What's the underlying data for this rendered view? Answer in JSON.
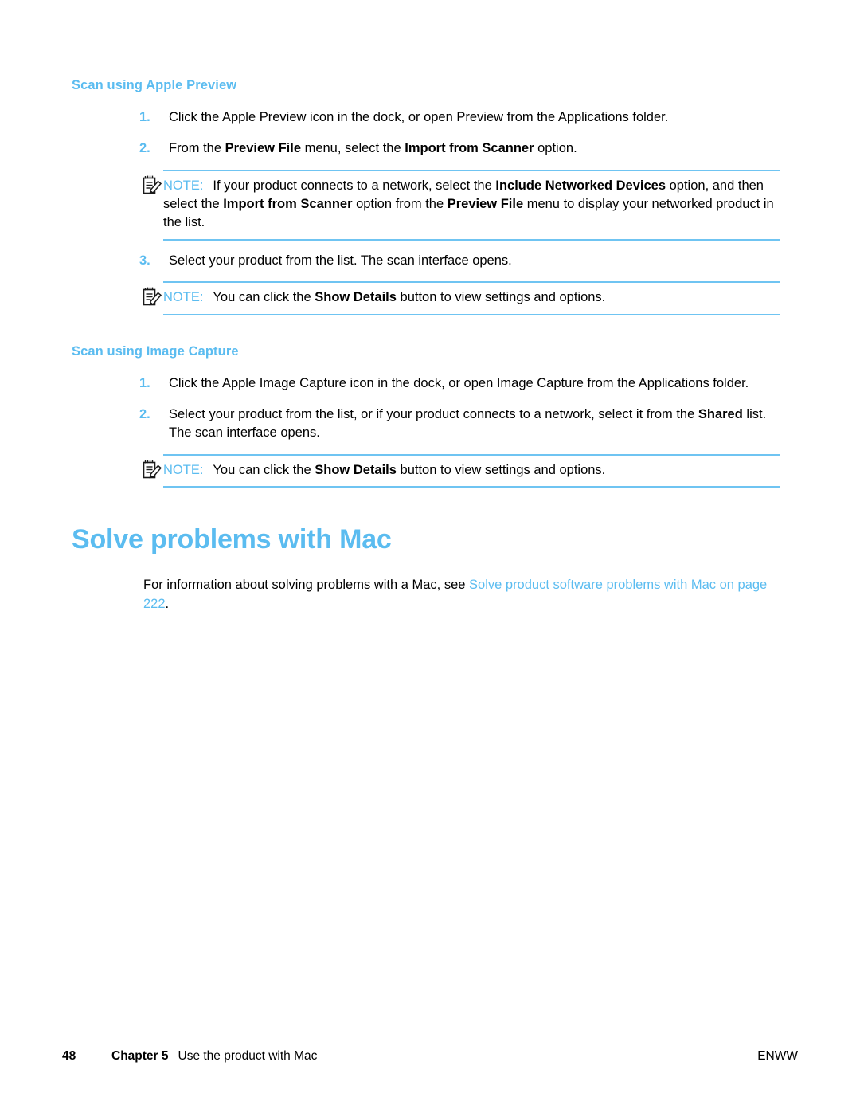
{
  "sections": [
    {
      "heading": "Scan using Apple Preview",
      "steps": [
        {
          "num": "1.",
          "runs": [
            {
              "t": "Click the Apple Preview icon in the dock, or open Preview from the Applications folder.",
              "b": false
            }
          ]
        },
        {
          "num": "2.",
          "runs": [
            {
              "t": "From the ",
              "b": false
            },
            {
              "t": "Preview File",
              "b": true
            },
            {
              "t": " menu, select the ",
              "b": false
            },
            {
              "t": "Import from Scanner",
              "b": true
            },
            {
              "t": " option.",
              "b": false
            }
          ]
        }
      ]
    }
  ],
  "note1": {
    "icon": "note-pad-pencil-icon",
    "label": "NOTE:",
    "runs": [
      {
        "t": "If your product connects to a network, select the ",
        "b": false
      },
      {
        "t": "Include Networked Devices",
        "b": true
      },
      {
        "t": " option, and then select the ",
        "b": false
      },
      {
        "t": "Import from Scanner",
        "b": true
      },
      {
        "t": " option from the ",
        "b": false
      },
      {
        "t": "Preview File",
        "b": true
      },
      {
        "t": " menu to display your networked product in the list.",
        "b": false
      }
    ]
  },
  "step3": {
    "num": "3.",
    "runs": [
      {
        "t": "Select your product from the list. The scan interface opens.",
        "b": false
      }
    ]
  },
  "note2": {
    "icon": "note-pad-pencil-icon",
    "label": "NOTE:",
    "runs": [
      {
        "t": "You can click the ",
        "b": false
      },
      {
        "t": "Show Details",
        "b": true
      },
      {
        "t": " button to view settings and options.",
        "b": false
      }
    ]
  },
  "section2": {
    "heading": "Scan using Image Capture",
    "steps": [
      {
        "num": "1.",
        "runs": [
          {
            "t": "Click the Apple Image Capture icon in the dock, or open Image Capture from the Applications folder.",
            "b": false
          }
        ]
      },
      {
        "num": "2.",
        "runs": [
          {
            "t": "Select your product from the list, or if your product connects to a network, select it from the ",
            "b": false
          },
          {
            "t": "Shared",
            "b": true
          },
          {
            "t": " list. The scan interface opens.",
            "b": false
          }
        ]
      }
    ]
  },
  "note3": {
    "icon": "note-pad-pencil-icon",
    "label": "NOTE:",
    "runs": [
      {
        "t": "You can click the ",
        "b": false
      },
      {
        "t": "Show Details",
        "b": true
      },
      {
        "t": " button to view settings and options.",
        "b": false
      }
    ]
  },
  "solve": {
    "heading": "Solve problems with Mac",
    "intro": "For information about solving problems with a Mac, see ",
    "link": "Solve product software problems with Mac on page 222",
    "period": "."
  },
  "footer": {
    "page_number": "48",
    "chapter": "Chapter 5",
    "chapter_title": "Use the product with Mac",
    "locale": "ENWW"
  },
  "colors": {
    "accent_blue": "#5BBCF0",
    "rule_blue": "#6FC4F2",
    "text_black": "#000000"
  }
}
